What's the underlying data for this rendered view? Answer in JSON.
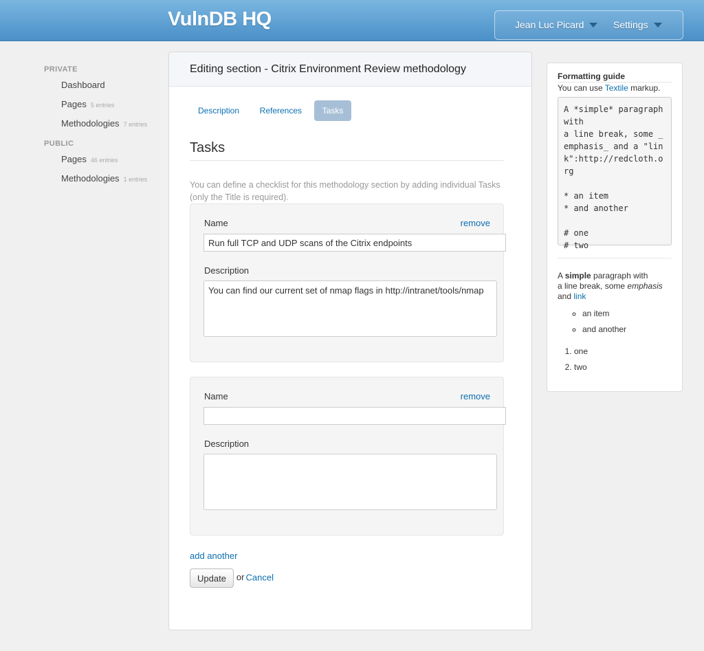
{
  "header": {
    "brand": "VulnDB HQ",
    "user_menu": "Jean Luc Picard",
    "settings_menu": "Settings"
  },
  "sidebar": {
    "private_heading": "PRIVATE",
    "public_heading": "PUBLIC",
    "private_items": [
      {
        "label": "Dashboard",
        "count": ""
      },
      {
        "label": "Pages",
        "count": "5 entries"
      },
      {
        "label": "Methodologies",
        "count": "7 entries"
      }
    ],
    "public_items": [
      {
        "label": "Pages",
        "count": "46 entries"
      },
      {
        "label": "Methodologies",
        "count": "1 entries"
      }
    ]
  },
  "main": {
    "title": "Editing section - Citrix Environment Review methodology",
    "tabs": [
      {
        "label": "Description",
        "active": false
      },
      {
        "label": "References",
        "active": false
      },
      {
        "label": "Tasks",
        "active": true
      }
    ],
    "section_title": "Tasks",
    "help_text": "You can define a checklist for this methodology section by adding individual Tasks (only the Title is required).",
    "name_label": "Name",
    "description_label": "Description",
    "remove_label": "remove",
    "tasks": [
      {
        "name": "Run full TCP and UDP scans of the Citrix endpoints",
        "description": "You can find our current set of nmap flags in http://intranet/tools/nmap"
      },
      {
        "name": "",
        "description": ""
      }
    ],
    "add_another": "add another",
    "update_button": "Update",
    "or_text": "or",
    "cancel_link": "Cancel"
  },
  "guide": {
    "title": "Formatting guide",
    "intro_before": "You can use",
    "intro_link": "Textile",
    "intro_after": "markup.",
    "code": "A *simple* paragraph with\na line break, some _emphasis_ and a \"link\":http://redcloth.org\n\n* an item\n* and another\n\n# one\n# two",
    "preview": {
      "p_a": "A",
      "p_strong": "simple",
      "p_b": "paragraph with",
      "p_c": "a line break, some",
      "p_em": "emphasis",
      "p_and": "and",
      "p_link": "link",
      "bullets": [
        "an item",
        "and another"
      ],
      "numbers": [
        "one",
        "two"
      ]
    }
  }
}
